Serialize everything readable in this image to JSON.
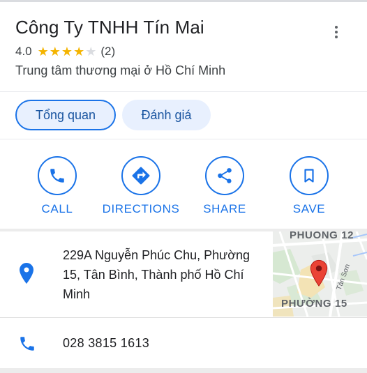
{
  "place": {
    "name": "Công Ty TNHH Tín Mai",
    "rating": "4.0",
    "rating_value": 4,
    "review_count": "(2)",
    "category": "Trung tâm thương mại ở Hồ Chí Minh"
  },
  "tabs": [
    {
      "label": "Tổng quan",
      "selected": true
    },
    {
      "label": "Đánh giá",
      "selected": false
    }
  ],
  "actions": [
    {
      "label": "CALL",
      "icon": "phone-icon"
    },
    {
      "label": "DIRECTIONS",
      "icon": "directions-icon"
    },
    {
      "label": "SHARE",
      "icon": "share-icon"
    },
    {
      "label": "SAVE",
      "icon": "bookmark-icon"
    }
  ],
  "address": {
    "text": "229A Nguyễn Phúc Chu, Phường 15, Tân Bình, Thành phố Hồ Chí Minh",
    "icon": "location-pin-icon"
  },
  "map": {
    "label_top": "PHUONG 12",
    "label_bottom": "PHƯỜNG 15",
    "street": "Tân Sơn"
  },
  "phone": {
    "number": "028 3815 1613",
    "icon": "phone-icon"
  },
  "colors": {
    "accent": "#1a73e8",
    "star": "#f4b400",
    "pin": "#ea4335",
    "tab_bg": "#e8f0fe"
  }
}
